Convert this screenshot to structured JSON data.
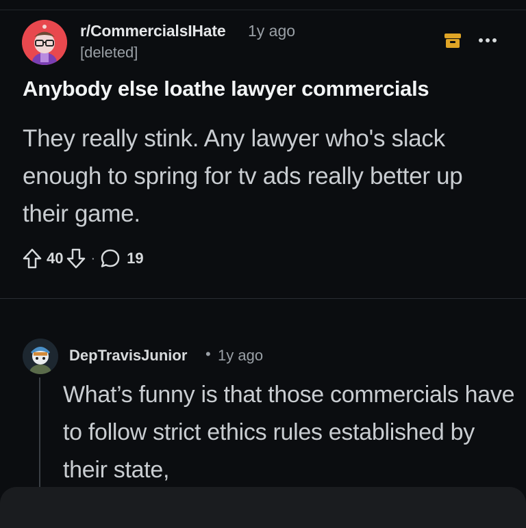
{
  "post": {
    "subreddit": "r/CommercialsIHate",
    "time": "1y ago",
    "author": "[deleted]",
    "title": "Anybody else loathe lawyer commercials",
    "body": "They really stink. Any lawyer who's slack enough to spring for tv ads really better up their game.",
    "upvotes": "40",
    "separator": "·",
    "comments": "19"
  },
  "comment": {
    "author": "DepTravisJunior",
    "separator": "•",
    "time": "1y ago",
    "body": "What’s funny is that those commercials have to follow strict ethics rules established by their state,"
  },
  "icons": {
    "archive": "archive-icon",
    "more": "more-dots-icon",
    "upvote": "upvote-arrow-icon",
    "downvote": "downvote-arrow-icon",
    "comment": "comment-bubble-icon"
  },
  "colors": {
    "background": "#0b0d10",
    "subreddit_avatar": "#e8484e",
    "archive_icon": "#e0a526",
    "text_primary": "#f2f4f5",
    "text_secondary": "#9aa0a6"
  }
}
